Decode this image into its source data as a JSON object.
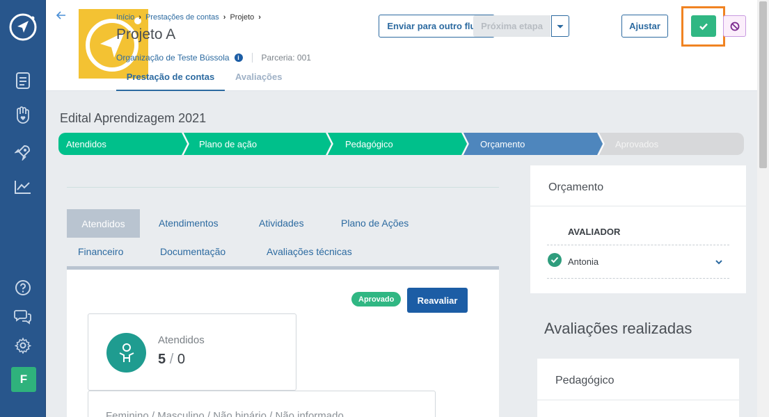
{
  "sidebar": {
    "icons": [
      "logo-icon",
      "document-icon",
      "hand-heart-icon",
      "rocket-icon",
      "chart-icon",
      "help-icon",
      "chat-icon",
      "settings-icon"
    ],
    "avatar_letter": "F"
  },
  "header": {
    "breadcrumb": [
      "Início",
      "Prestações de contas",
      "Projeto"
    ],
    "title": "Projeto A",
    "organization": "Organização de Teste Bússola",
    "parceria": "Parceria: 001",
    "tabs": [
      "Prestação de contas",
      "Avaliações"
    ],
    "buttons": {
      "send_flow": "Enviar para outro fluxo",
      "next_step": "Próxima etapa",
      "adjust": "Ajustar"
    }
  },
  "main": {
    "edital_title": "Edital Aprendizagem 2021",
    "steps": [
      {
        "label": "Atendidos",
        "status": "done"
      },
      {
        "label": "Plano de ação",
        "status": "done"
      },
      {
        "label": "Pedagógico",
        "status": "done"
      },
      {
        "label": "Orçamento",
        "status": "current"
      },
      {
        "label": "Aprovados",
        "status": "pending"
      }
    ],
    "content_tabs": [
      "Atendidos",
      "Atendimentos",
      "Atividades",
      "Plano de Ações",
      "Financeiro",
      "Documentação",
      "Avaliações técnicas"
    ],
    "badge": "Aprovado",
    "reevaluate": "Reavaliar",
    "stat": {
      "label": "Atendidos",
      "value": "5",
      "total": "0"
    },
    "gender_label": "Feminino / Masculino / Não binário / Não informado"
  },
  "right": {
    "section_title": "Orçamento",
    "evaluator_header": "AVALIADOR",
    "evaluator_name": "Antonia",
    "realizadas_title": "Avaliações realizadas",
    "realizada_item": "Pedagógico"
  },
  "colors": {
    "sidebar": "#28568c",
    "accent": "#2c6aa0",
    "step_done": "#00c08b",
    "step_current": "#4e86bd",
    "step_pending": "#d7d8da",
    "approve": "#30b783",
    "highlight": "#f08322"
  }
}
